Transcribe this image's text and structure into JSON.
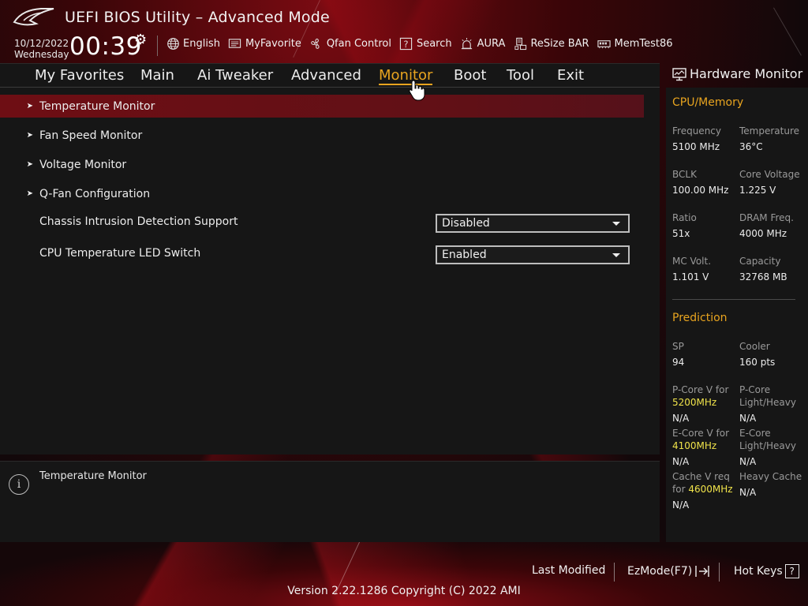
{
  "header": {
    "title": "UEFI BIOS Utility – Advanced Mode",
    "date": "10/12/2022",
    "weekday": "Wednesday",
    "time": "00:39",
    "toolbar": [
      {
        "label": "English",
        "icon": "globe-icon"
      },
      {
        "label": "MyFavorite",
        "icon": "favorite-icon"
      },
      {
        "label": "Qfan Control",
        "icon": "fan-icon"
      },
      {
        "label": "Search",
        "icon": "search-icon"
      },
      {
        "label": "AURA",
        "icon": "aura-icon"
      },
      {
        "label": "ReSize BAR",
        "icon": "resize-bar-icon"
      },
      {
        "label": "MemTest86",
        "icon": "memtest-icon"
      }
    ]
  },
  "tabs": [
    {
      "label": "My Favorites"
    },
    {
      "label": "Main"
    },
    {
      "label": "Ai Tweaker"
    },
    {
      "label": "Advanced"
    },
    {
      "label": "Monitor",
      "active": true
    },
    {
      "label": "Boot"
    },
    {
      "label": "Tool"
    },
    {
      "label": "Exit"
    }
  ],
  "menu": [
    {
      "label": "Temperature Monitor",
      "selected": true
    },
    {
      "label": "Fan Speed Monitor"
    },
    {
      "label": "Voltage Monitor"
    },
    {
      "label": "Q-Fan Configuration"
    }
  ],
  "settings": [
    {
      "label": "Chassis Intrusion Detection Support",
      "value": "Disabled"
    },
    {
      "label": "CPU Temperature LED Switch",
      "value": "Enabled"
    }
  ],
  "help": {
    "text": "Temperature Monitor"
  },
  "hardware_monitor": {
    "title": "Hardware Monitor",
    "cpu_memory": {
      "heading": "CPU/Memory",
      "items": [
        {
          "key": "Frequency",
          "value": "5100 MHz"
        },
        {
          "key": "Temperature",
          "value": "36°C"
        },
        {
          "key": "BCLK",
          "value": "100.00 MHz"
        },
        {
          "key": "Core Voltage",
          "value": "1.225 V"
        },
        {
          "key": "Ratio",
          "value": "51x"
        },
        {
          "key": "DRAM Freq.",
          "value": "4000 MHz"
        },
        {
          "key": "MC Volt.",
          "value": "1.101 V"
        },
        {
          "key": "Capacity",
          "value": "32768 MB"
        }
      ]
    },
    "prediction": {
      "heading": "Prediction",
      "sp": {
        "key": "SP",
        "value": "94"
      },
      "cooler": {
        "key": "Cooler",
        "value": "160 pts"
      },
      "pcore_v": {
        "key": "P-Core V for",
        "freq": "5200MHz",
        "value": "N/A"
      },
      "pcore_lh": {
        "key1": "P-Core",
        "key2": "Light/Heavy",
        "value": "N/A"
      },
      "ecore_v": {
        "key": "E-Core V for",
        "freq": "4100MHz",
        "value": "N/A"
      },
      "ecore_lh": {
        "key1": "E-Core",
        "key2": "Light/Heavy",
        "value": "N/A"
      },
      "cache_v": {
        "key1": "Cache V req",
        "key2": "for",
        "freq": "4600MHz",
        "value": "N/A"
      },
      "heavy_cache": {
        "key": "Heavy Cache",
        "value": "N/A"
      }
    }
  },
  "footer": {
    "last_modified": "Last Modified",
    "ezmode": "EzMode(F7)",
    "hotkeys": "Hot Keys",
    "hotkeys_key": "?",
    "version": "Version 2.22.1286 Copyright (C) 2022 AMI"
  },
  "colors": {
    "accent": "#e8a41f",
    "selection": "#6e0e14",
    "highlight": "#f0e34a"
  }
}
